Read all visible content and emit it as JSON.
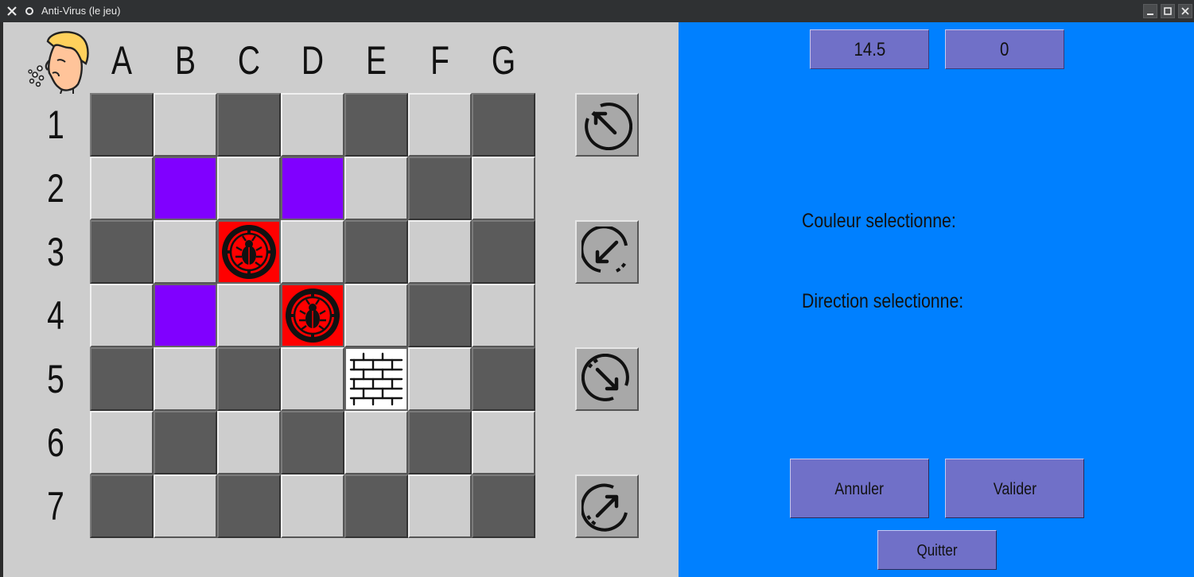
{
  "window": {
    "title": "Anti-Virus (le jeu)"
  },
  "board": {
    "columns": [
      "A",
      "B",
      "C",
      "D",
      "E",
      "F",
      "G"
    ],
    "rows": [
      "1",
      "2",
      "3",
      "4",
      "5",
      "6",
      "7"
    ],
    "grid": [
      [
        "dark",
        "light",
        "dark",
        "light",
        "dark",
        "light",
        "dark"
      ],
      [
        "light",
        "purple",
        "light",
        "purple",
        "light",
        "dark",
        "light"
      ],
      [
        "dark",
        "light",
        "virus",
        "light",
        "dark",
        "light",
        "dark"
      ],
      [
        "light",
        "purple",
        "light",
        "virus",
        "light",
        "dark",
        "light"
      ],
      [
        "dark",
        "light",
        "dark",
        "light",
        "wall",
        "light",
        "dark"
      ],
      [
        "light",
        "dark",
        "light",
        "dark",
        "light",
        "dark",
        "light"
      ],
      [
        "dark",
        "light",
        "dark",
        "light",
        "dark",
        "light",
        "dark"
      ]
    ],
    "colors": {
      "dark": "#5b5b5b",
      "light": "#cdcdcd",
      "purple": "#8000ff",
      "virus": "#ff0000",
      "wall": "#ffffff"
    },
    "icons": {
      "virus": "bug-icon",
      "wall": "brick-wall-icon",
      "mascot": "sneezing-person-icon"
    }
  },
  "direction_buttons": [
    {
      "name": "up-left",
      "icon": "arrow-up-left-icon"
    },
    {
      "name": "down-left",
      "icon": "arrow-down-left-icon"
    },
    {
      "name": "down-right",
      "icon": "arrow-down-right-icon"
    },
    {
      "name": "up-right",
      "icon": "arrow-up-right-icon"
    }
  ],
  "scores": {
    "time": "14.5",
    "moves": "0"
  },
  "info": {
    "color_label": "Couleur selectionne:",
    "direction_label": "Direction selectionne:"
  },
  "actions": {
    "cancel": "Annuler",
    "validate": "Valider",
    "quit": "Quitter"
  },
  "theme": {
    "panel_blue": "#0080ff",
    "button_color": "#7070c8"
  }
}
